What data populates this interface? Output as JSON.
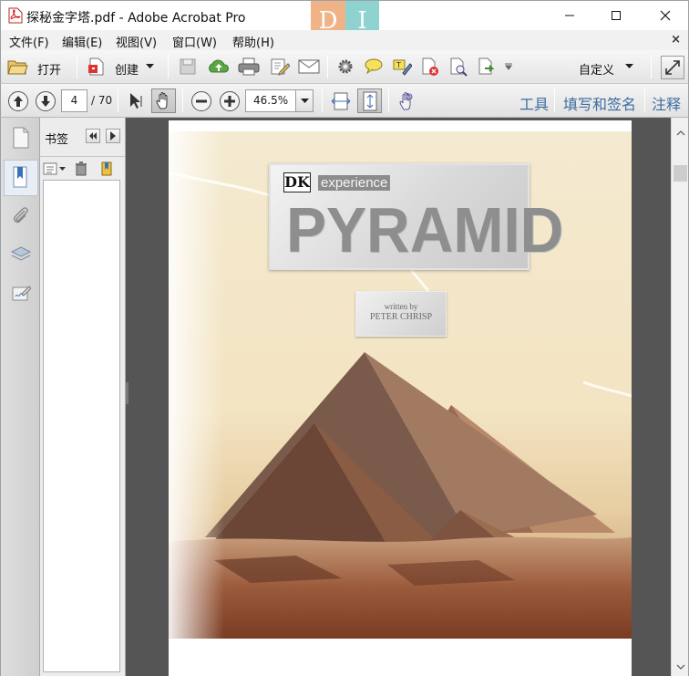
{
  "window": {
    "title": "探秘金字塔.pdf - Adobe Acrobat Pro",
    "watermark_left": "D",
    "watermark_right": "I"
  },
  "menu": {
    "items": [
      "文件(F)",
      "编辑(E)",
      "视图(V)",
      "窗口(W)",
      "帮助(H)"
    ],
    "close": "×"
  },
  "toolbar": {
    "open_label": "打开",
    "create_label": "创建",
    "customize_label": "自定义"
  },
  "nav_toolbar": {
    "page_current": "4",
    "page_total": "/ 70",
    "zoom": "46.5%"
  },
  "panes": {
    "tools": "工具",
    "fill_sign": "填写和签名",
    "comment": "注释"
  },
  "bookmarks": {
    "title": "书签"
  },
  "document": {
    "brand": "DK",
    "series": "experience",
    "title": "PYRAMID",
    "written_by": "written by",
    "author": "PETER CHRISP"
  },
  "colors": {
    "pane_link": "#3d6c9e",
    "doc_background": "#555555"
  }
}
